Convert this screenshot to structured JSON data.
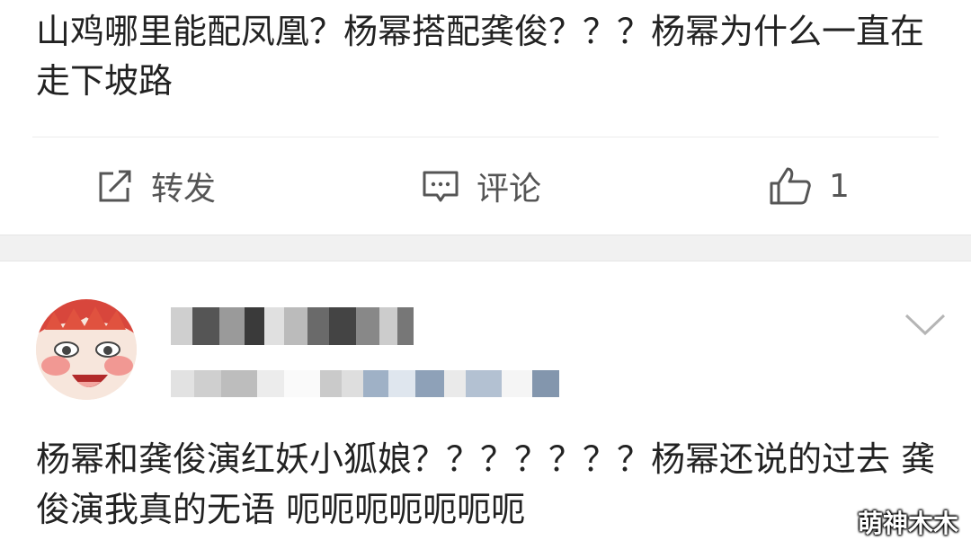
{
  "post": {
    "text": "山鸡哪里能配凤凰？杨幂搭配龚俊？？？杨幂为什么一直在走下坡路"
  },
  "actions": {
    "repost_label": "转发",
    "comment_label": "评论",
    "like_count": "1"
  },
  "comment": {
    "username": "",
    "meta": "",
    "text": "杨幂和龚俊演红妖小狐娘？？？？？？？杨幂还说的过去 龚俊演我真的无语 呃呃呃呃呃呃呃"
  },
  "watermark": "萌神木木",
  "icons": {
    "repost": "share-square-icon",
    "comment": "speech-bubble-icon",
    "like": "thumbs-up-icon",
    "more": "chevron-down-icon"
  },
  "colors": {
    "background": "#ffffff",
    "separator": "#f1f1f1",
    "text": "#222222",
    "action_text": "#555555"
  }
}
